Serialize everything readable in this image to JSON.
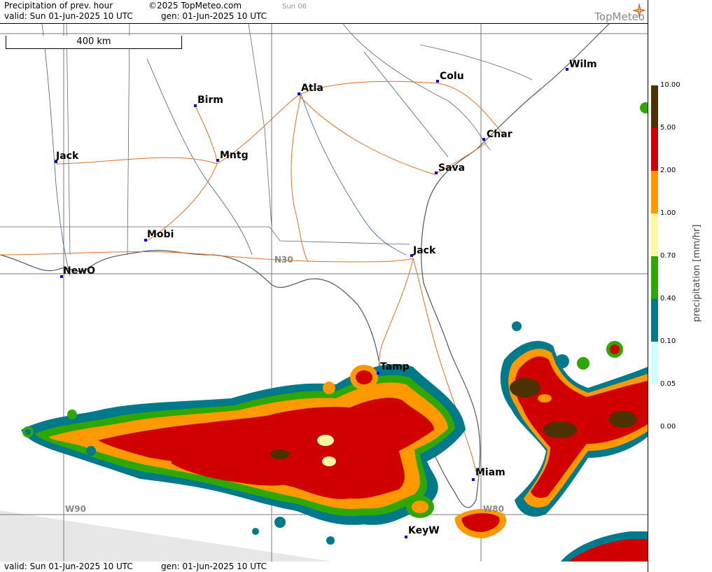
{
  "header": {
    "title": "Precipitation of prev. hour",
    "copyright": "©2025 TopMeteo.com",
    "day_tag": "Sun 06",
    "valid": "valid:  Sun  01-Jun-2025  10 UTC",
    "gen": "gen: 01-Jun-2025 10 UTC",
    "logo": "TopMeteo"
  },
  "footer": {
    "valid": "valid:  Sun  01-Jun-2025  10 UTC",
    "gen": "gen: 01-Jun-2025 10 UTC"
  },
  "map": {
    "scale_label": "400 km",
    "grid_labels": {
      "n30": "N30",
      "w90": "W90",
      "w80": "W80"
    },
    "cities": [
      {
        "name": "Wilm"
      },
      {
        "name": "Colu"
      },
      {
        "name": "Atla"
      },
      {
        "name": "Birm"
      },
      {
        "name": "Char"
      },
      {
        "name": "Jack"
      },
      {
        "name": "Mntg"
      },
      {
        "name": "Sava"
      },
      {
        "name": "Mobi"
      },
      {
        "name": "Jack"
      },
      {
        "name": "NewO"
      },
      {
        "name": "Tamp"
      },
      {
        "name": "Miam"
      },
      {
        "name": "KeyW"
      }
    ]
  },
  "legend": {
    "unit": "precipitation  [mm/hr]",
    "ticks": [
      "10.00",
      "5.00",
      "2.00",
      "1.00",
      "0.70",
      "0.40",
      "0.10",
      "0.05",
      "0.00"
    ],
    "colors": [
      "#4d3100",
      "#d10000",
      "#ff9900",
      "#fff8a0",
      "#2ea800",
      "#007a8a",
      "#ccffff",
      "#ffffff"
    ]
  }
}
